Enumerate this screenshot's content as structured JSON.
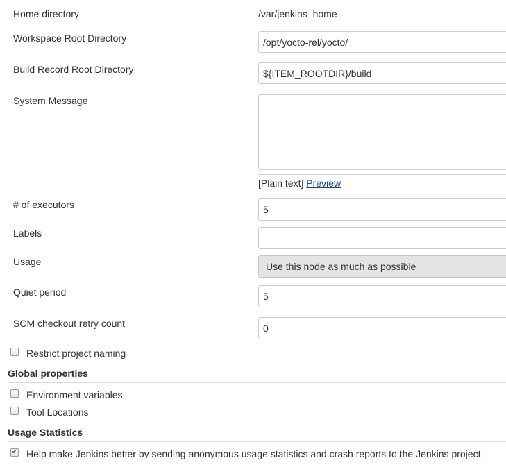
{
  "home_directory": {
    "label": "Home directory",
    "value": "/var/jenkins_home"
  },
  "workspace_root": {
    "label": "Workspace Root Directory",
    "value": "/opt/yocto-rel/yocto/"
  },
  "build_record_root": {
    "label": "Build Record Root Directory",
    "value": "${ITEM_ROOTDIR}/build"
  },
  "system_message": {
    "label": "System Message",
    "value": "",
    "format_prefix": "[Plain text]",
    "preview_link": "Preview"
  },
  "executors": {
    "label": "# of executors",
    "value": "5"
  },
  "labels": {
    "label": "Labels",
    "value": ""
  },
  "usage": {
    "label": "Usage",
    "selected": "Use this node as much as possible"
  },
  "quiet_period": {
    "label": "Quiet period",
    "value": "5"
  },
  "scm_retry": {
    "label": "SCM checkout retry count",
    "value": "0"
  },
  "restrict_naming": {
    "label": "Restrict project naming",
    "checked": false
  },
  "global_properties": {
    "title": "Global properties",
    "items": [
      {
        "label": "Environment variables",
        "checked": false
      },
      {
        "label": "Tool Locations",
        "checked": false
      }
    ]
  },
  "usage_statistics": {
    "title": "Usage Statistics",
    "item": {
      "label": "Help make Jenkins better by sending anonymous usage statistics and crash reports to the Jenkins project.",
      "checked": true
    }
  },
  "checkmark_glyph": "✔"
}
